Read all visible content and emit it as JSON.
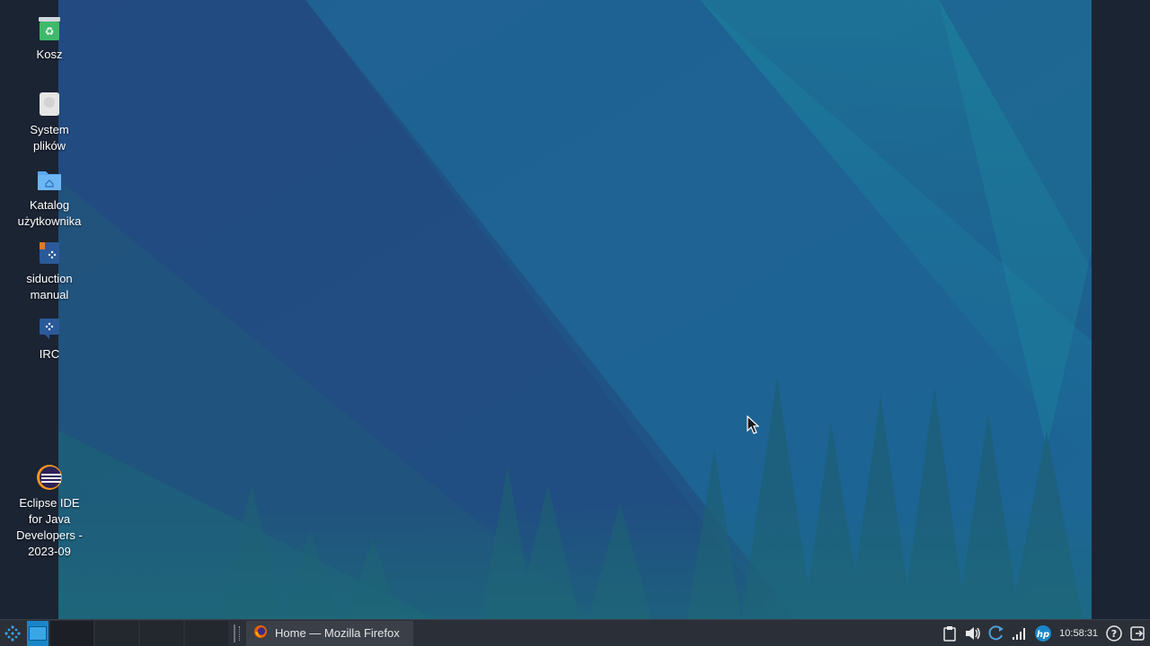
{
  "desktop": {
    "icons": [
      {
        "label": "Kosz",
        "icon": "trash-icon"
      },
      {
        "label": "System\nplików",
        "icon": "drive-icon"
      },
      {
        "label": "Katalog\nużytkownika",
        "icon": "home-folder-icon"
      },
      {
        "label": "siduction\nmanual",
        "icon": "manual-icon"
      },
      {
        "label": "IRC",
        "icon": "irc-icon"
      },
      {
        "label": "Eclipse IDE\nfor Java\nDevelopers -\n2023-09",
        "icon": "eclipse-icon"
      }
    ]
  },
  "taskbar": {
    "tasks": [
      {
        "label": "Home — Mozilla Firefox",
        "icon": "firefox-icon"
      }
    ],
    "clock": "10:58:31",
    "tray_icons": [
      "clipboard-icon",
      "volume-icon",
      "update-icon",
      "network-icon",
      "hp-icon",
      "help-icon",
      "logout-icon"
    ]
  },
  "colors": {
    "taskbar_bg": "#2b3038",
    "accent": "#1a86c8",
    "desktop_margin": "#1b2433"
  }
}
